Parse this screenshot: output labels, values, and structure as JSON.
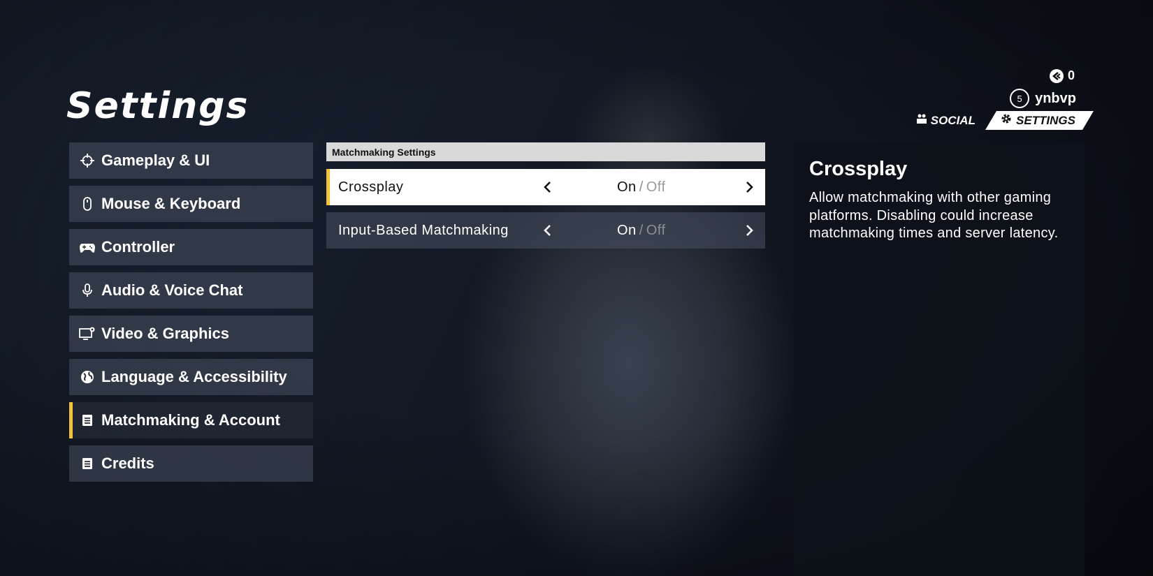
{
  "header": {
    "title": "Settings",
    "currency": {
      "icon": "currency-coin-icon",
      "value": "0"
    },
    "user": {
      "level": "5",
      "name": "ynbvp"
    },
    "nav": {
      "social": "SOCIAL",
      "settings": "SETTINGS"
    }
  },
  "sidebar": {
    "items": [
      {
        "label": "Gameplay & UI",
        "icon": "crosshair-icon"
      },
      {
        "label": "Mouse & Keyboard",
        "icon": "mouse-icon"
      },
      {
        "label": "Controller",
        "icon": "gamepad-icon"
      },
      {
        "label": "Audio & Voice Chat",
        "icon": "microphone-icon"
      },
      {
        "label": "Video & Graphics",
        "icon": "monitor-gear-icon"
      },
      {
        "label": "Language & Accessibility",
        "icon": "globe-icon"
      },
      {
        "label": "Matchmaking & Account",
        "icon": "document-icon",
        "active": true
      },
      {
        "label": "Credits",
        "icon": "document-icon"
      }
    ]
  },
  "main": {
    "section_title": "Matchmaking Settings",
    "rows": [
      {
        "label": "Crossplay",
        "on": "On",
        "sep": "/",
        "off": "Off",
        "selected": "On"
      },
      {
        "label": "Input-Based Matchmaking",
        "on": "On",
        "sep": "/",
        "off": "Off",
        "selected": "On"
      }
    ]
  },
  "info": {
    "title": "Crossplay",
    "description": "Allow matchmaking with other gaming platforms. Disabling could increase matchmaking times and server latency."
  },
  "colors": {
    "accent": "#f2c23a",
    "selected_row_bg": "#ffffff",
    "section_header_bg": "#d9d9d9"
  }
}
